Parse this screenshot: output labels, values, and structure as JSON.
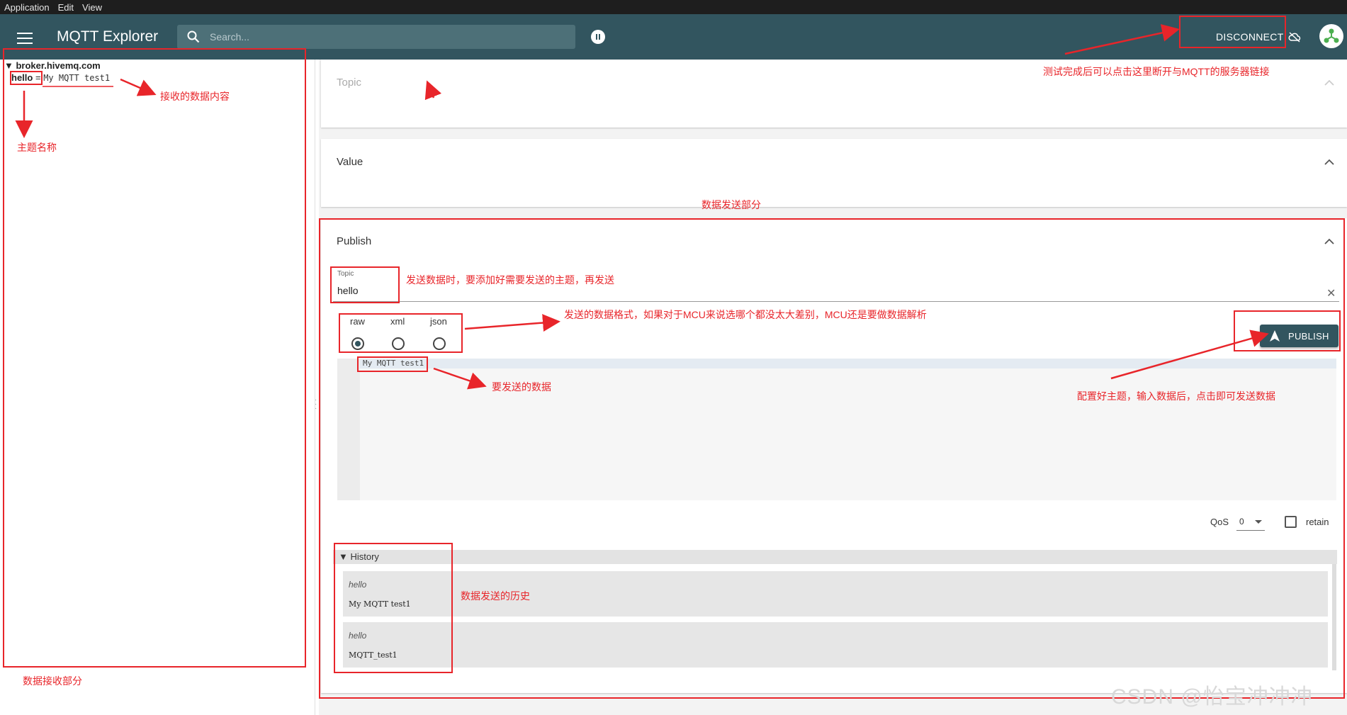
{
  "menu": [
    "Application",
    "Edit",
    "View"
  ],
  "app": {
    "title": "MQTT Explorer",
    "search_placeholder": "Search...",
    "disconnect_label": "DISCONNECT"
  },
  "tree": {
    "broker": "broker.hivemq.com",
    "topic": "hello",
    "separator": "=",
    "value": "My MQTT test1"
  },
  "panels": {
    "topic_title": "Topic",
    "value_title": "Value",
    "publish_title": "Publish"
  },
  "publish": {
    "topic_label": "Topic",
    "topic_value": "hello",
    "formats": [
      {
        "label": "raw",
        "selected": true
      },
      {
        "label": "xml",
        "selected": false
      },
      {
        "label": "json",
        "selected": false
      }
    ],
    "payload": "My MQTT test1",
    "button_label": "PUBLISH",
    "qos_label": "QoS",
    "qos_value": "0",
    "retain_label": "retain"
  },
  "history": {
    "title": "History",
    "items": [
      {
        "topic": "hello",
        "payload": "My MQTT test1"
      },
      {
        "topic": "hello",
        "payload": "MQTT_test1"
      }
    ]
  },
  "annotations": {
    "received_content": "接收的数据内容",
    "topic_name": "主题名称",
    "receive_section": "数据接收部分",
    "disconnect_hint": "测试完成后可以点击这里断开与MQTT的服务器链接",
    "send_section": "数据发送部分",
    "topic_hint": "发送数据时，要添加好需要发送的主题，再发送",
    "format_hint": "发送的数据格式，如果对于MCU来说选哪个都没太大差别，MCU还是要做数据解析",
    "data_hint": "要发送的数据",
    "publish_hint": "配置好主题，输入数据后，点击即可发送数据",
    "history_hint": "数据发送的历史"
  },
  "watermark": "CSDN @怡宝冲冲冲",
  "colors": {
    "appbar": "#32555f",
    "annotation": "#e8252a"
  }
}
